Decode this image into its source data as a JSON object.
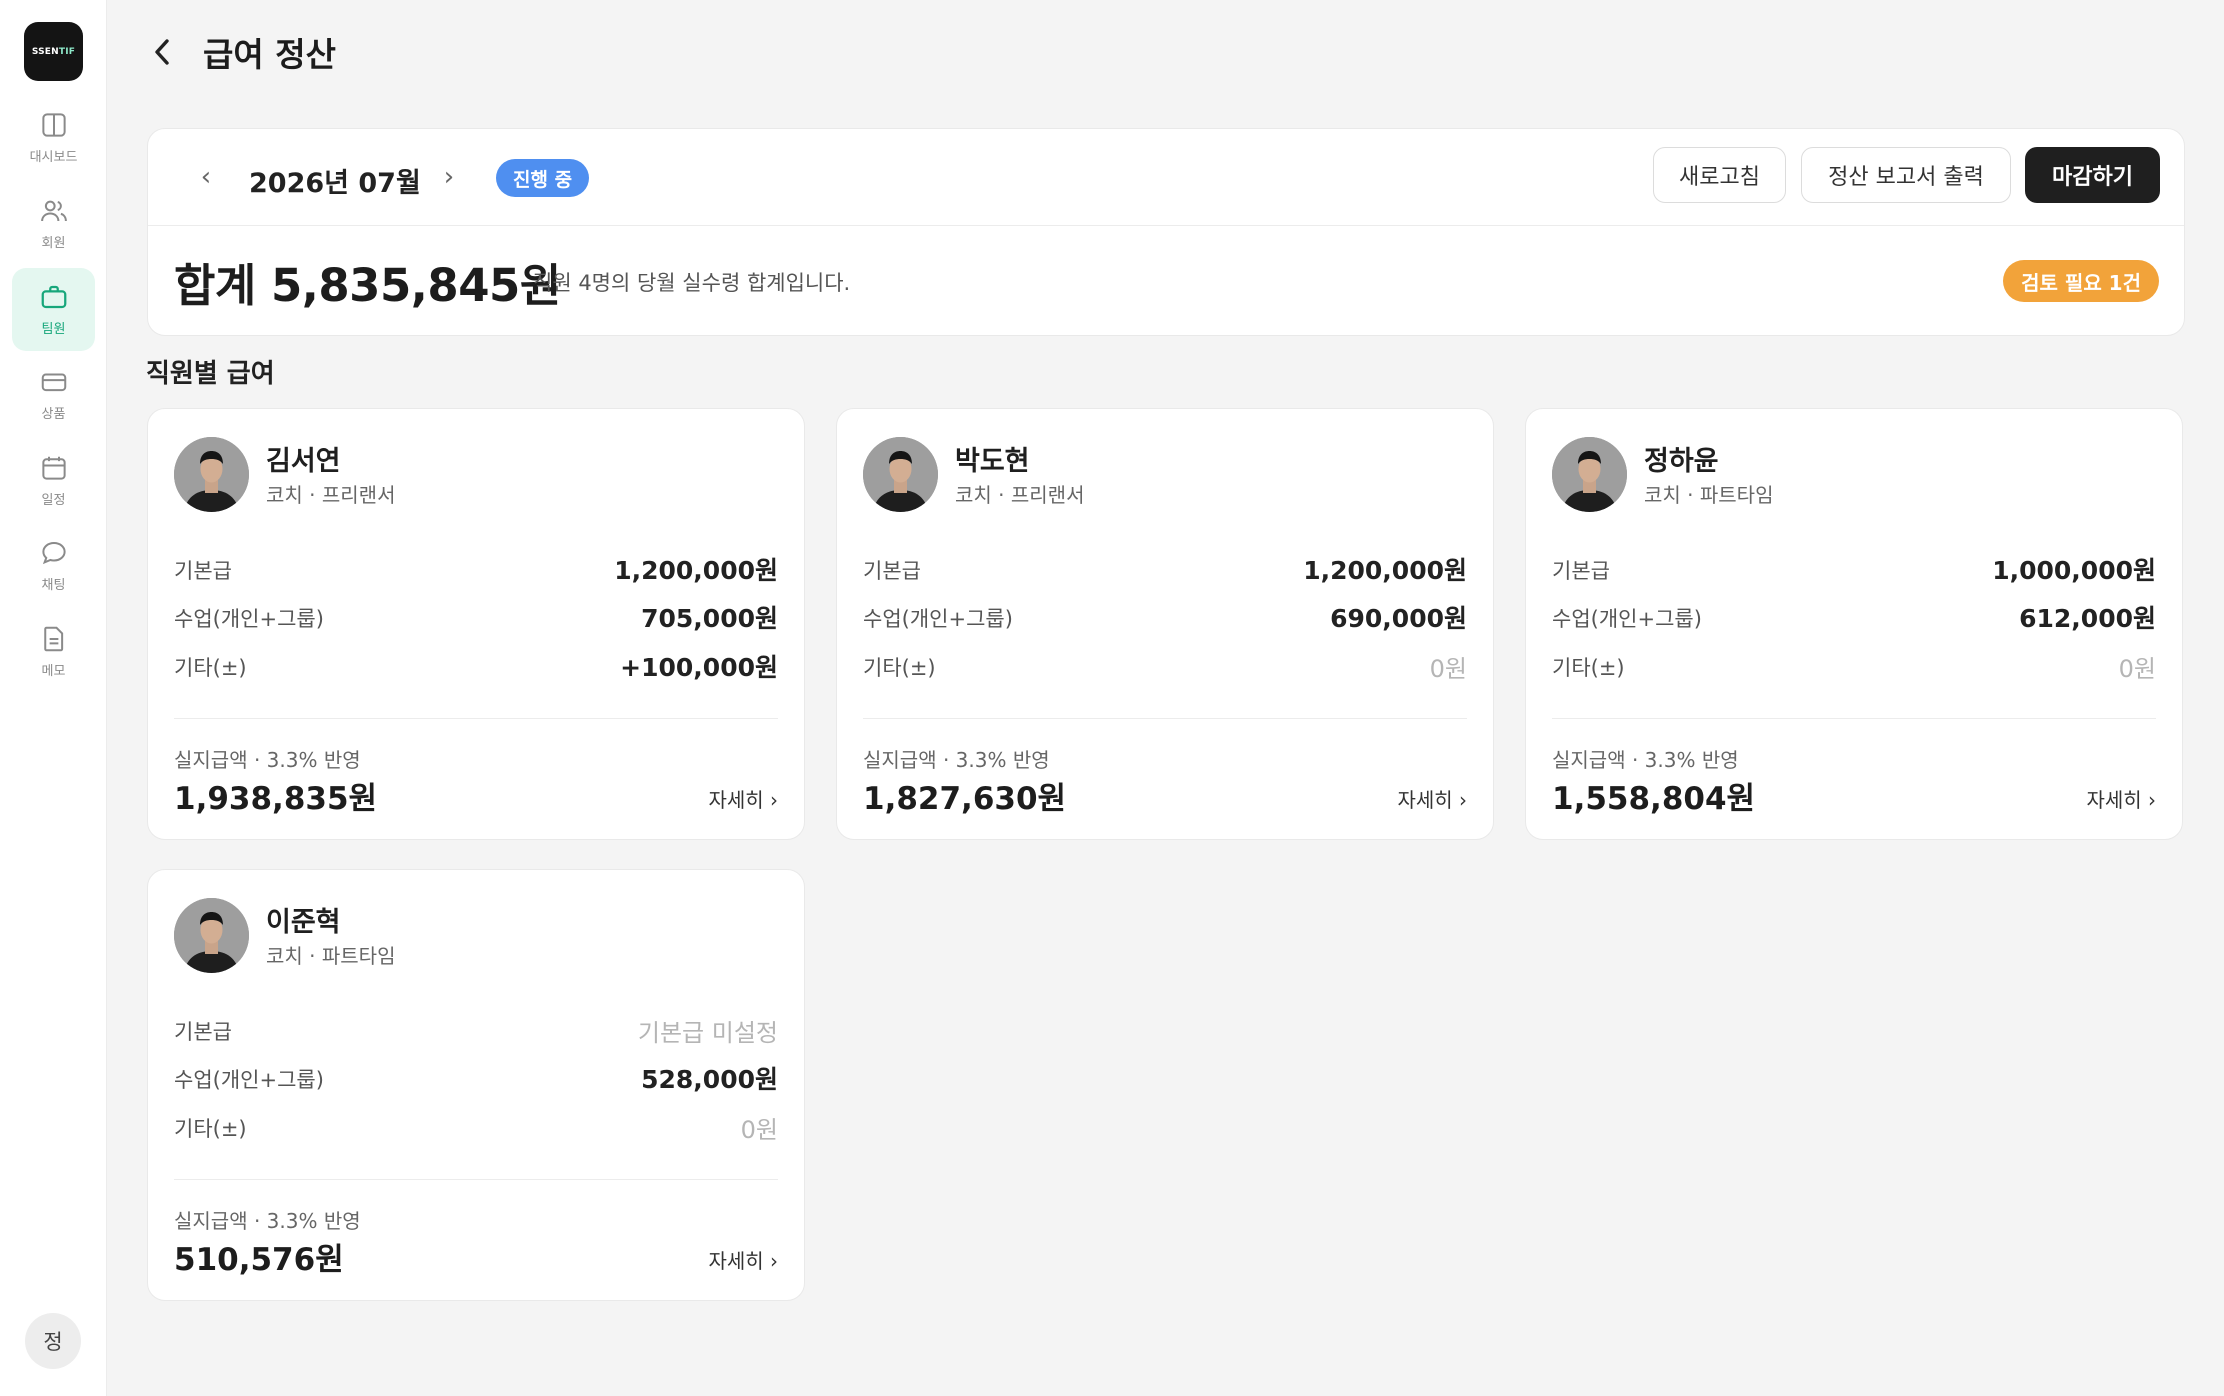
{
  "sidebar": {
    "logo_text": "SSENTIF",
    "logo_main": "SSEN",
    "logo_accent": "TIF",
    "items": [
      {
        "label": "대시보드",
        "icon": "dashboard-icon",
        "active": false
      },
      {
        "label": "회원",
        "icon": "members-icon",
        "active": false
      },
      {
        "label": "팀원",
        "icon": "briefcase-icon",
        "active": true
      },
      {
        "label": "상품",
        "icon": "card-icon",
        "active": false
      },
      {
        "label": "일정",
        "icon": "calendar-icon",
        "active": false
      },
      {
        "label": "채팅",
        "icon": "chat-icon",
        "active": false
      },
      {
        "label": "메모",
        "icon": "memo-icon",
        "active": false
      }
    ],
    "user_initial": "정",
    "accent_color": "#17a77b"
  },
  "header": {
    "title": "급여 정산"
  },
  "summary": {
    "prev_glyph": "‹",
    "next_glyph": "›",
    "month": "2026년 07월",
    "status": "진행 중",
    "buttons": {
      "refresh": "새로고침",
      "print": "정산 보고서 출력",
      "close": "마감하기"
    },
    "total": "합계 5,835,845원",
    "description": "직원 4명의 당월 실수령 합계입니다.",
    "review_badge": "검토 필요 1건"
  },
  "section_title": "직원별 급여",
  "employees": [
    {
      "name": "김서연",
      "role": "코치 · 프리랜서",
      "rows": [
        {
          "label": "기본급",
          "value": "1,200,000원"
        },
        {
          "label": "수업(개인+그룹)",
          "value": "705,000원"
        },
        {
          "label": "기타(±)",
          "value": "+100,000원"
        }
      ],
      "net_label": "실지급액 · 3.3% 반영",
      "net_value": "1,938,835원",
      "detail": "자세히 ›"
    },
    {
      "name": "박도현",
      "role": "코치 · 프리랜서",
      "rows": [
        {
          "label": "기본급",
          "value": "1,200,000원"
        },
        {
          "label": "수업(개인+그룹)",
          "value": "690,000원"
        },
        {
          "label": "기타(±)",
          "value": "0원"
        }
      ],
      "net_label": "실지급액 · 3.3% 반영",
      "net_value": "1,827,630원",
      "detail": "자세히 ›"
    },
    {
      "name": "정하윤",
      "role": "코치 · 파트타임",
      "rows": [
        {
          "label": "기본급",
          "value": "1,000,000원"
        },
        {
          "label": "수업(개인+그룹)",
          "value": "612,000원"
        },
        {
          "label": "기타(±)",
          "value": "0원"
        }
      ],
      "net_label": "실지급액 · 3.3% 반영",
      "net_value": "1,558,804원",
      "detail": "자세히 ›"
    },
    {
      "name": "이준혁",
      "role": "코치 · 파트타임",
      "rows": [
        {
          "label": "기본급",
          "value": "기본급 미설정"
        },
        {
          "label": "수업(개인+그룹)",
          "value": "528,000원"
        },
        {
          "label": "기타(±)",
          "value": "0원"
        }
      ],
      "net_label": "실지급액 · 3.3% 반영",
      "net_value": "510,576원",
      "detail": "자세히 ›"
    }
  ]
}
